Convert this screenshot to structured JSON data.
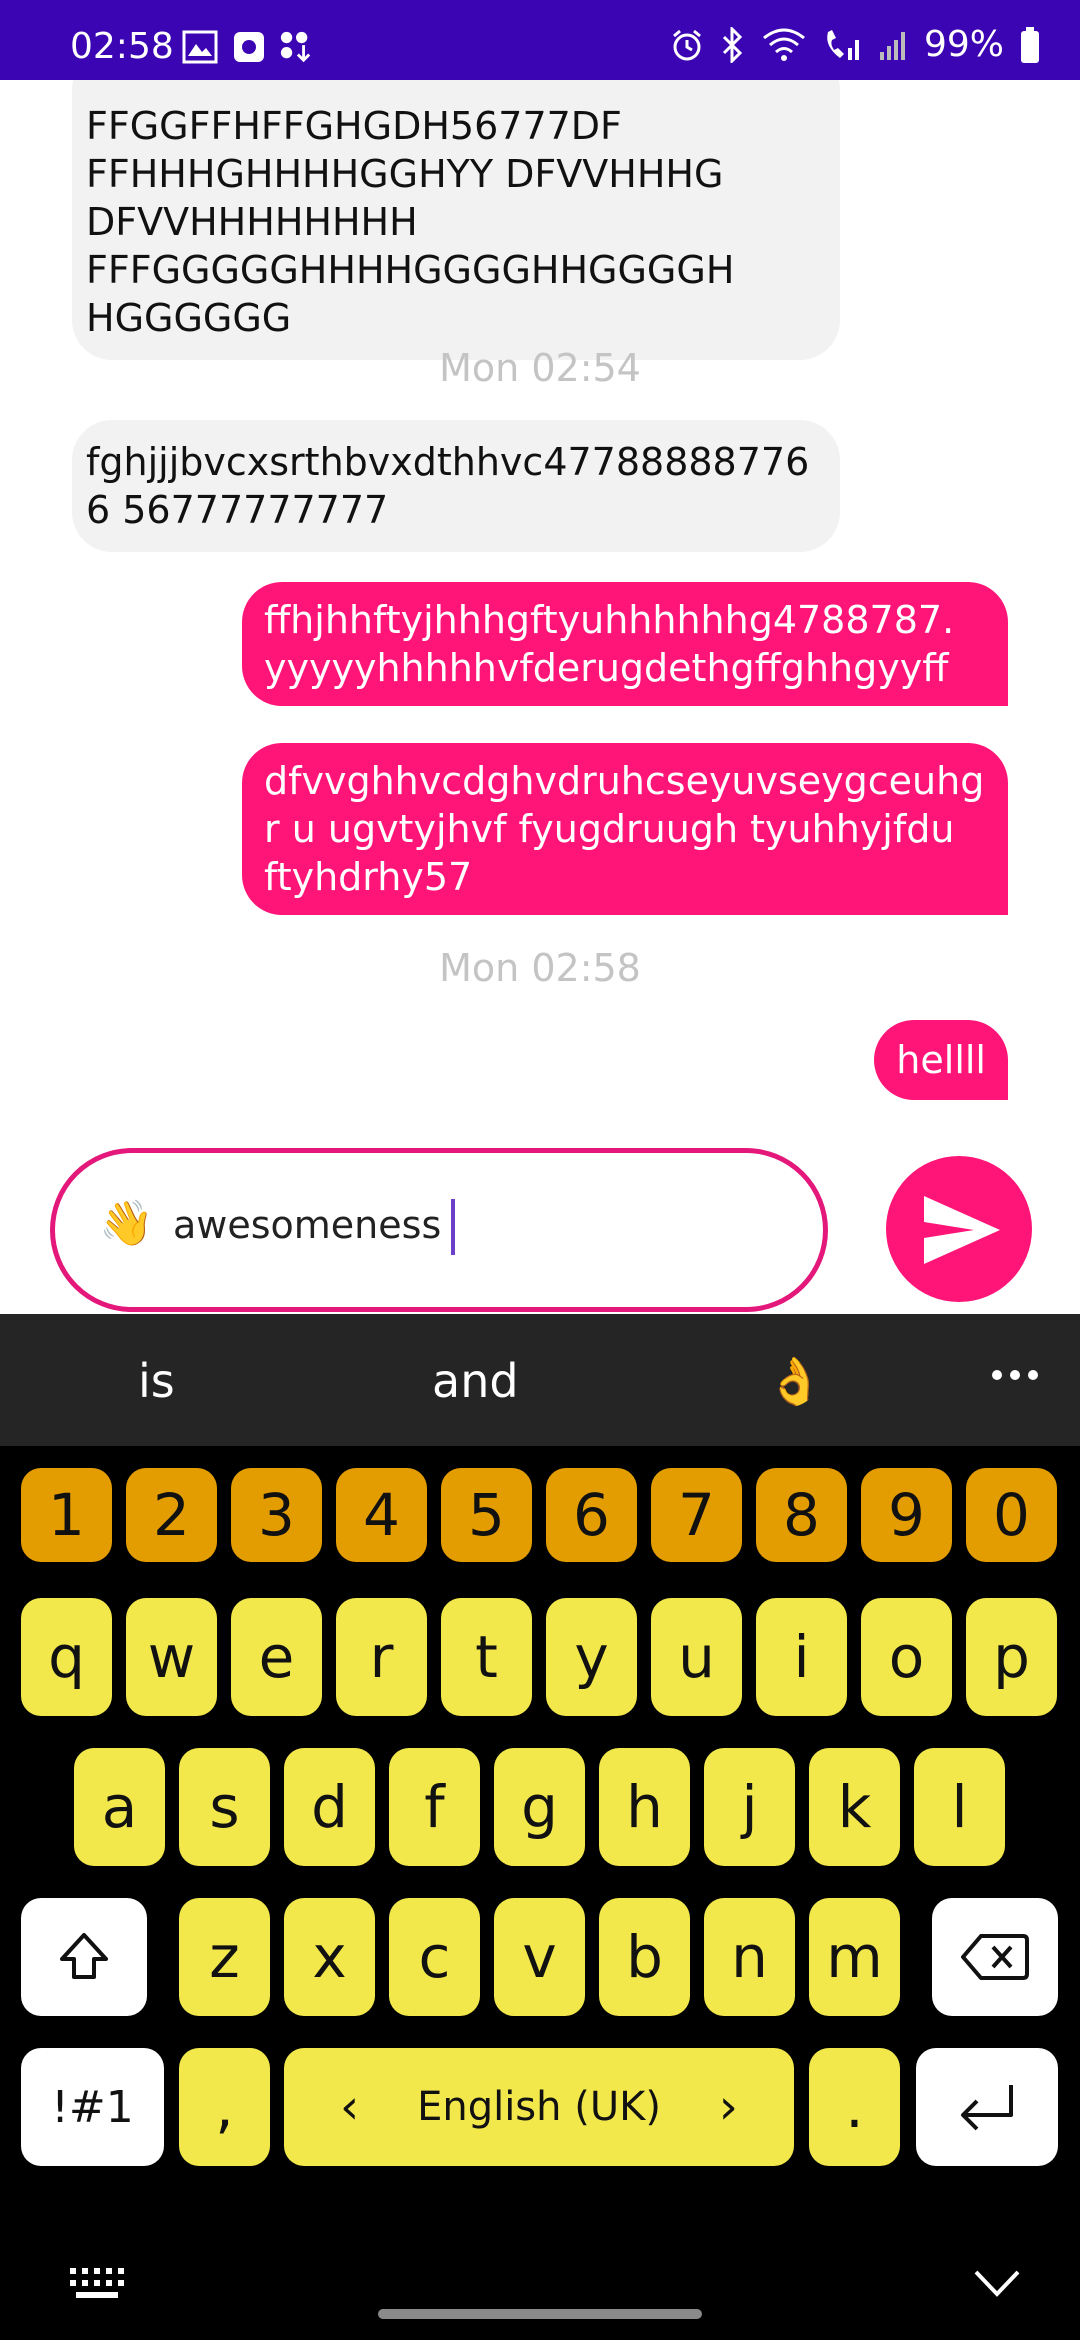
{
  "status_bar": {
    "time": "02:58",
    "battery": "99%",
    "icons": [
      "gallery-icon",
      "app-icon",
      "grid-download-icon",
      "alarm-icon",
      "bluetooth-icon",
      "wifi-icon",
      "call-signal-icon",
      "cell-signal-icon",
      "battery-icon"
    ]
  },
  "messages": [
    {
      "direction": "in",
      "text": "FFGGFFHFFGHGDH56777DF FFHHHGHHHHGGHYY DFVVHHHG DFVVHHHHHHHH FFFGGGGGHHHHGGGGHHGGGGH HGGGGGG"
    },
    {
      "type": "timestamp",
      "text": "Mon 02:54"
    },
    {
      "direction": "in",
      "text": "fghjjjbvcxsrthbvxdthhvc477888887766 56777777777"
    },
    {
      "direction": "out",
      "text": "ffhjhhftyjhhhgftyuhhhhhhg4788787. yyyyyhhhhhvfderugdethgffghhgyyff"
    },
    {
      "direction": "out",
      "text": "dfvvghhvcdghvdruhcseyuvseygceuhgr u ugvtyjhvf fyugdruugh tyuhhyjfdu ftyhdrhy57"
    },
    {
      "type": "timestamp",
      "text": "Mon 02:58"
    },
    {
      "direction": "out",
      "text": "hellll"
    }
  ],
  "composer": {
    "emoji": "👋",
    "value": "awesomeness"
  },
  "suggestions": {
    "items": [
      "is",
      "and",
      "👌"
    ],
    "more_icon": "more-icon"
  },
  "keyboard": {
    "numbers": [
      "1",
      "2",
      "3",
      "4",
      "5",
      "6",
      "7",
      "8",
      "9",
      "0"
    ],
    "row1": [
      "q",
      "w",
      "e",
      "r",
      "t",
      "y",
      "u",
      "i",
      "o",
      "p"
    ],
    "row2": [
      "a",
      "s",
      "d",
      "f",
      "g",
      "h",
      "j",
      "k",
      "l"
    ],
    "row3": [
      "z",
      "x",
      "c",
      "v",
      "b",
      "n",
      "m"
    ],
    "symbols_label": "!#1",
    "comma": ",",
    "language": "English (UK)",
    "period": ".",
    "left_arrow": "‹",
    "right_arrow": "›"
  },
  "colors": {
    "status_bar": "#3c05b4",
    "accent": "#ff1477",
    "key_yellow": "#f2e84c",
    "key_orange": "#e39d00"
  }
}
